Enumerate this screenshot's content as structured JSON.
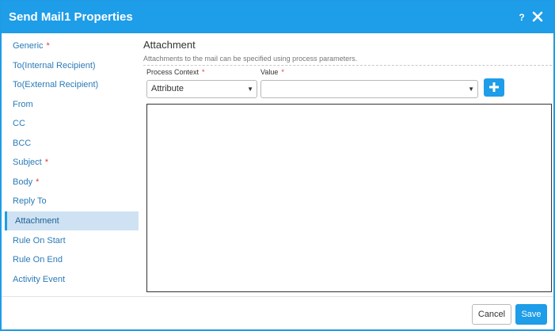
{
  "dialog": {
    "title": "Send Mail1 Properties",
    "help_label": "?",
    "accent_color": "#1e9de8"
  },
  "sidebar": {
    "items": [
      {
        "label": "Generic",
        "required": "*"
      },
      {
        "label": "To(Internal Recipient)",
        "required": ""
      },
      {
        "label": "To(External Recipient)",
        "required": ""
      },
      {
        "label": "From",
        "required": ""
      },
      {
        "label": "CC",
        "required": ""
      },
      {
        "label": "BCC",
        "required": ""
      },
      {
        "label": "Subject",
        "required": "*"
      },
      {
        "label": "Body",
        "required": "*"
      },
      {
        "label": "Reply To",
        "required": ""
      },
      {
        "label": "Attachment",
        "required": ""
      },
      {
        "label": "Rule On Start",
        "required": ""
      },
      {
        "label": "Rule On End",
        "required": ""
      },
      {
        "label": "Activity Event",
        "required": ""
      }
    ],
    "active": "Attachment"
  },
  "main": {
    "section_title": "Attachment",
    "section_description": "Attachments to the mail can be specified using process parameters.",
    "process_context": {
      "label": "Process Context",
      "required": "*",
      "value": "Attribute"
    },
    "value_field": {
      "label": "Value",
      "required": "*",
      "value": ""
    }
  },
  "footer": {
    "cancel_label": "Cancel",
    "save_label": "Save"
  }
}
